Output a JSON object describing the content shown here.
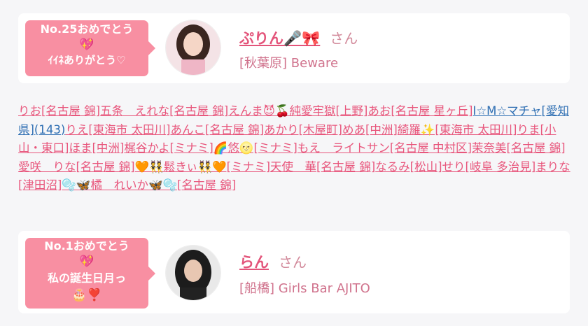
{
  "card1": {
    "badge_line1": "No.25おめでとう",
    "badge_line2": "💖",
    "badge_line3": "ｲｲﾈありがとう♡",
    "name": "ぷりん🎤🎀",
    "san": "さん",
    "shop": "[秋葉原] Beware"
  },
  "names_list": [
    {
      "text": "りお[名古屋 錦]",
      "color": "pink"
    },
    {
      "text": "五条　えれな[名古屋 錦]",
      "color": "pink"
    },
    {
      "text": "えんま😈🍒",
      "color": "pink"
    },
    {
      "text": "純愛牢獄[上野]",
      "color": "pink"
    },
    {
      "text": "あお[名古屋 星ヶ丘]",
      "color": "pink"
    },
    {
      "text": "I☆M☆マチャ[愛知県](143)",
      "color": "blue"
    },
    {
      "text": "りえ[東海市 太田川]",
      "color": "pink"
    },
    {
      "text": "あんこ[名古屋 錦]",
      "color": "pink"
    },
    {
      "text": "あかり[木屋町]",
      "color": "pink"
    },
    {
      "text": "めあ[中洲]",
      "color": "pink"
    },
    {
      "text": "綺羅✨[東海市 太田川]",
      "color": "pink"
    },
    {
      "text": "りま[小山・東口]",
      "color": "pink"
    },
    {
      "text": "ほま[中洲]",
      "color": "pink"
    },
    {
      "text": "梶谷かよ[ミナミ]",
      "color": "pink"
    },
    {
      "text": "🌈悠🌝[ミナミ]",
      "color": "pink"
    },
    {
      "text": "もえ　ライトサン[名古屋 中村区]",
      "color": "pink"
    },
    {
      "text": "茉奈美[名古屋 錦]",
      "color": "pink"
    },
    {
      "text": "愛咲　りな[名古屋 錦]",
      "color": "pink"
    },
    {
      "text": "🧡👯鬆きぃ👯🧡[ミナミ]",
      "color": "pink"
    },
    {
      "text": "天使　華[名古屋 錦]",
      "color": "pink"
    },
    {
      "text": "なるみ[松山]",
      "color": "pink"
    },
    {
      "text": "せり[岐阜 多治見]",
      "color": "pink"
    },
    {
      "text": "まりな[津田沼]",
      "color": "pink"
    },
    {
      "text": "🫧🦋橘　れいか🦋🫧[名古屋 錦]",
      "color": "pink"
    }
  ],
  "card2": {
    "badge_line1": "No.1おめでとう",
    "badge_line2": "💖",
    "badge_line3": "私の誕生日月っ",
    "badge_line4": "🎂❣️",
    "name": "らん",
    "san": "さん",
    "shop": "[船橋] Girls Bar AJITO"
  }
}
